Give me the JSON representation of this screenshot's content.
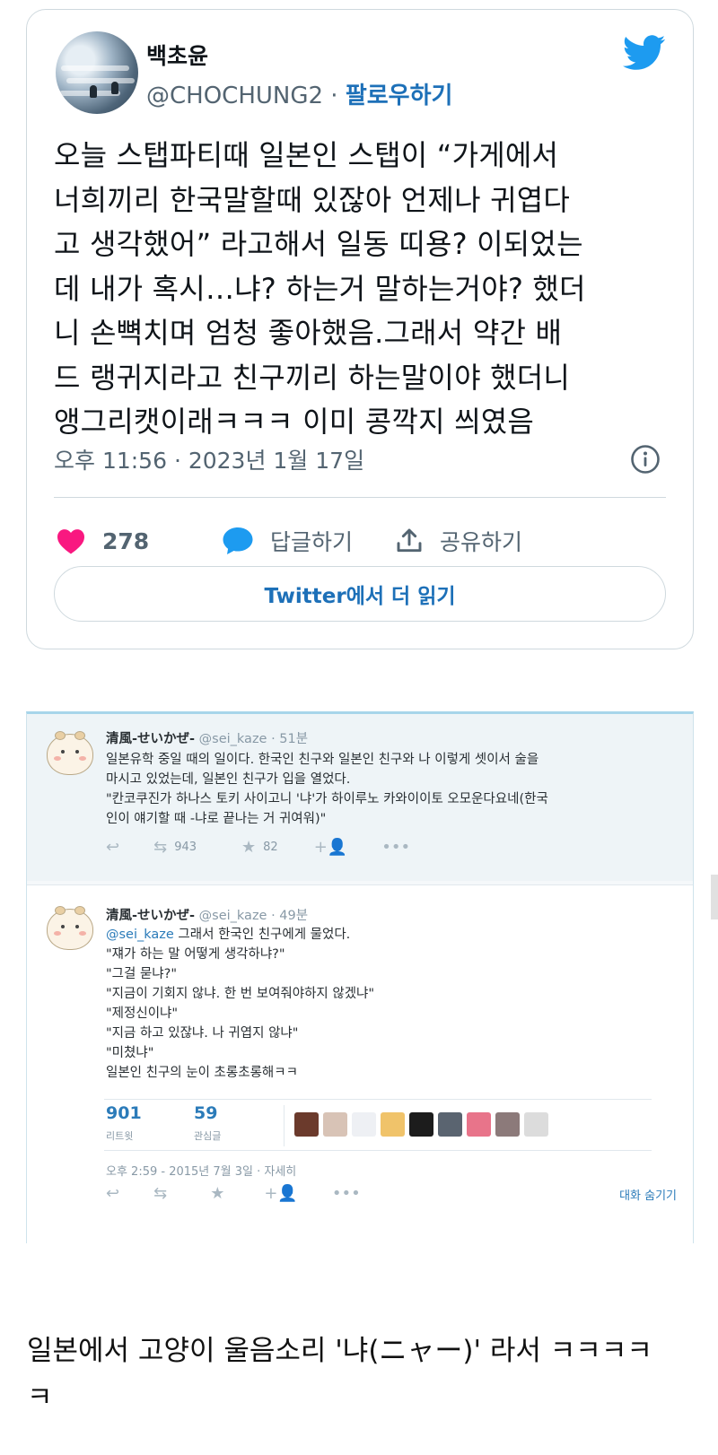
{
  "tweet": {
    "author_name": "백초윤",
    "handle": "@CHOCHUNG2",
    "separator": " · ",
    "follow_label": "팔로우하기",
    "body_lines": [
      "오늘 스탭파티때 일본인 스탭이 “가게에서",
      "너희끼리 한국말할때 있잖아 언제나 귀엽다",
      "고 생각했어” 라고해서 일동 띠용? 이되었는",
      "데 내가 혹시…냐? 하는거 말하는거야? 했더",
      "니 손뼉치며 엄청 좋아했음.그래서 약간 배",
      "드 랭귀지라고 친구끼리 하는말이야 했더니",
      "앵그리캣이래ㅋㅋㅋ 이미 콩깍지 씌였음"
    ],
    "timestamp": "오후 11:56 · 2023년 1월 17일",
    "like_count": "278",
    "reply_label": "답글하기",
    "share_label": "공유하기",
    "read_more_label": "Twitter에서 더 읽기",
    "colors": {
      "brand": "#1d9bf0",
      "like": "#f91880",
      "link": "#1d70b8"
    }
  },
  "old_thread": {
    "tweet1": {
      "name": "清風-せいかぜ-",
      "handle": "@sei_kaze",
      "time": "· 51분",
      "lines": [
        "일본유학 중일 때의 일이다. 한국인 친구와 일본인 친구와 나 이렇게 셋이서 술을",
        "마시고 있었는데, 일본인 친구가 입을 열었다.",
        "\"칸코쿠진가 하나스 토키 사이고니 '냐'가 하이루노 카와이이토 오모운다요네(한국",
        "인이 얘기할 때 -냐로 끝나는 거 귀여워)\""
      ],
      "retweets": "943",
      "favorites": "82"
    },
    "tweet2": {
      "name": "清風-せいかぜ-",
      "handle": "@sei_kaze",
      "time": "· 49분",
      "mention": "@sei_kaze",
      "first_line_rest": " 그래서 한국인 친구에게 물었다.",
      "lines": [
        "\"쟤가 하는 말 어떻게 생각하냐?\"",
        "\"그걸 묻냐?\"",
        "\"지금이 기회지 않냐. 한 번 보여줘야하지 않겠냐\"",
        "\"제정신이냐\"",
        "\"지금 하고 있잖냐. 나 귀엽지 않냐\"",
        "\"미쳤냐\"",
        "일본인 친구의 눈이 초롱초롱해ㅋㅋ"
      ],
      "retweet_count": "901",
      "retweet_label": "리트윗",
      "fav_count": "59",
      "fav_label": "관심글",
      "date": "오후 2:59 - 2015년 7월 3일 · 자세히",
      "hide_label": "대화 숨기기"
    }
  },
  "caption_lines": [
    "일본에서 고양이 울음소리 '냐(ニャー)' 라서 ㅋㅋㅋㅋ",
    "ㅋ"
  ]
}
